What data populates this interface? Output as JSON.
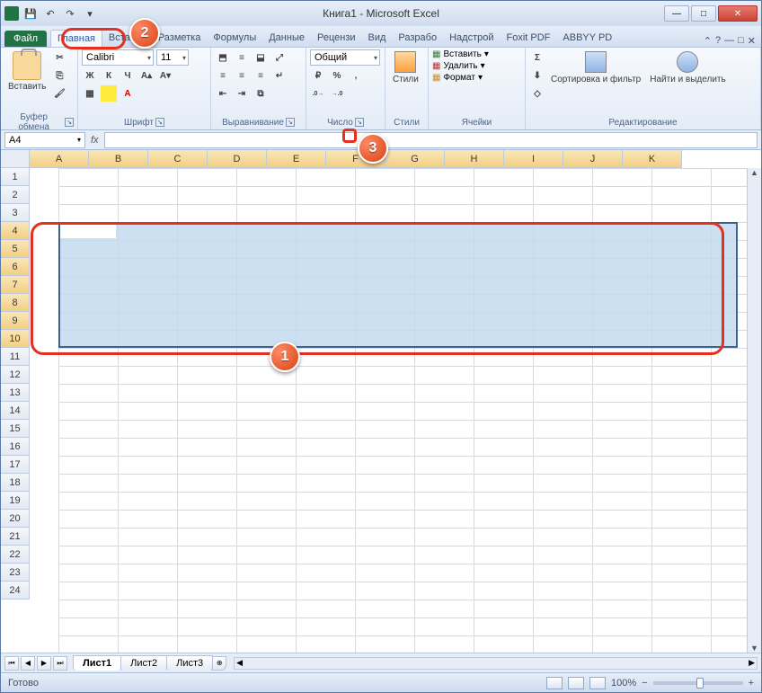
{
  "title": "Книга1 - Microsoft Excel",
  "qat": {
    "save": "💾",
    "undo": "↶",
    "redo": "↷",
    "more": "▾"
  },
  "win": {
    "min": "—",
    "max": "□",
    "close": "✕"
  },
  "tabs": {
    "file": "Файл",
    "items": [
      "Главная",
      "Вставка",
      "Разметка",
      "Формулы",
      "Данные",
      "Рецензи",
      "Вид",
      "Разрабо",
      "Надстрой",
      "Foxit PDF",
      "ABBYY PD"
    ],
    "active": "Главная",
    "help": "?"
  },
  "ribbon": {
    "clipboard": {
      "paste": "Вставить",
      "cut": "✂",
      "copy": "⎘",
      "brush": "🖌",
      "label": "Буфер обмена"
    },
    "font": {
      "name": "Calibri",
      "size": "11",
      "bold": "Ж",
      "italic": "К",
      "underline": "Ч",
      "border": "▦",
      "fill": "◢",
      "color": "A",
      "label": "Шрифт"
    },
    "align": {
      "label": "Выравнивание",
      "wrap": "↵",
      "merge": "⧉"
    },
    "number": {
      "label": "Число",
      "format": "Общий",
      "currency": "₽",
      "percent": "%",
      "comma": "000",
      "inc": ".0→.00",
      "dec": ".00→.0"
    },
    "styles": {
      "label": "Стили",
      "btn": "Стили"
    },
    "cells": {
      "label": "Ячейки",
      "insert": "Вставить",
      "delete": "Удалить",
      "format": "Формат"
    },
    "editing": {
      "label": "Редактирование",
      "sum": "Σ",
      "fill": "⬇",
      "clear": "◇",
      "sort": "Сортировка и фильтр",
      "find": "Найти и выделить"
    }
  },
  "namebox": "A4",
  "columns": [
    "A",
    "B",
    "C",
    "D",
    "E",
    "F",
    "G",
    "H",
    "I",
    "J",
    "K"
  ],
  "rows": [
    1,
    2,
    3,
    4,
    5,
    6,
    7,
    8,
    9,
    10,
    11,
    12,
    13,
    14,
    15,
    16,
    17,
    18,
    19,
    20,
    21,
    22,
    23,
    24
  ],
  "sel_rows": [
    4,
    5,
    6,
    7,
    8,
    9,
    10
  ],
  "sheets": [
    "Лист1",
    "Лист2",
    "Лист3"
  ],
  "active_sheet": "Лист1",
  "status": {
    "ready": "Готово",
    "zoom": "100%"
  },
  "callouts": {
    "c1": "1",
    "c2": "2",
    "c3": "3"
  }
}
